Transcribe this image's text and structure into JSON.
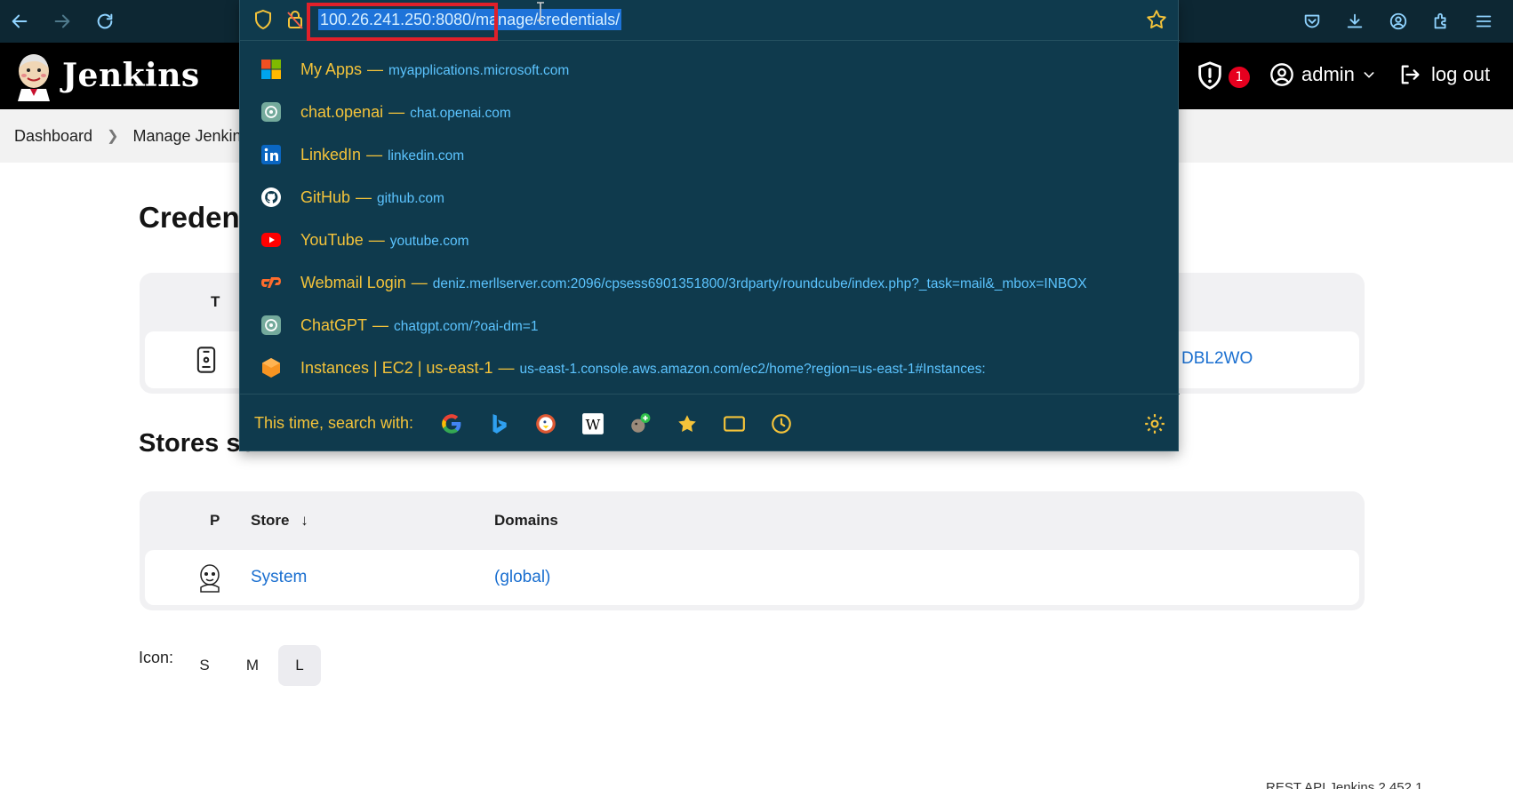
{
  "browser": {
    "url": "100.26.241.250:8080/manage/credentials/"
  },
  "header": {
    "title": "Jenkins",
    "notification_count": "1",
    "user": "admin",
    "logout": "log out"
  },
  "breadcrumb": {
    "items": [
      "Dashboard",
      "Manage Jenkin"
    ]
  },
  "page": {
    "title": "Credent",
    "credentials_table": {
      "col_type": "T",
      "row_partial_link": "DBL2WO"
    },
    "stores_title": "Stores sc",
    "stores_table": {
      "col_p": "P",
      "col_store": "Store",
      "sort_indicator": "↓",
      "col_domains": "Domains",
      "rows": [
        {
          "store": "System",
          "domain": "(global)"
        }
      ]
    },
    "icon_label": "Icon:",
    "icon_sizes": [
      "S",
      "M",
      "L"
    ],
    "footer": "REST API   Jenkins 2.452.1"
  },
  "dropdown": {
    "suggestions": [
      {
        "title": "My Apps",
        "url": "myapplications.microsoft.com",
        "icon": "microsoft-icon"
      },
      {
        "title": "chat.openai",
        "url": "chat.openai.com",
        "icon": "openai-icon"
      },
      {
        "title": "LinkedIn",
        "url": "linkedin.com",
        "icon": "linkedin-icon"
      },
      {
        "title": "GitHub",
        "url": "github.com",
        "icon": "github-icon"
      },
      {
        "title": "YouTube",
        "url": "youtube.com",
        "icon": "youtube-icon"
      },
      {
        "title": "Webmail Login",
        "url": "deniz.merllserver.com:2096/cpsess6901351800/3rdparty/roundcube/index.php?_task=mail&_mbox=INBOX",
        "icon": "cpanel-icon"
      },
      {
        "title": "ChatGPT",
        "url": "chatgpt.com/?oai-dm=1",
        "icon": "openai-icon"
      },
      {
        "title": "Instances | EC2 | us-east-1",
        "url": "us-east-1.console.aws.amazon.com/ec2/home?region=us-east-1#Instances:",
        "icon": "aws-icon"
      }
    ],
    "separator": "—",
    "search_with": "This time, search with:"
  },
  "colors": {
    "dropdown_bg": "#0f3a4d",
    "title_yellow": "#f4c33a",
    "url_blue": "#5cc4ff",
    "link_blue": "#1a6fd0",
    "highlight_red": "#e0202a"
  }
}
